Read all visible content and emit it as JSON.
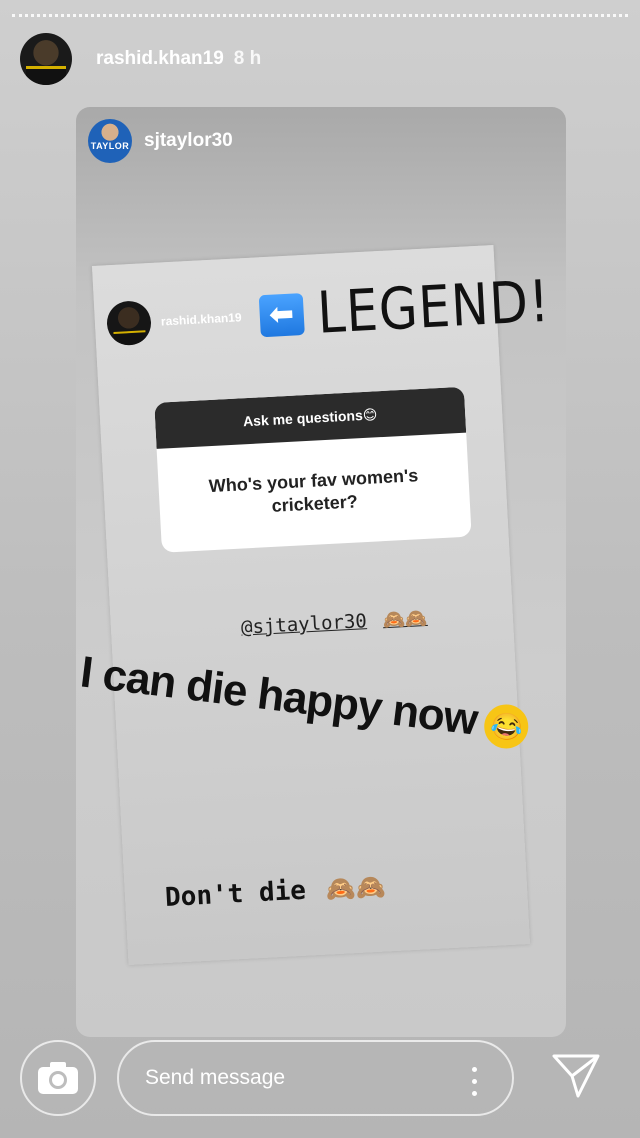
{
  "header": {
    "username": "rashid.khan19",
    "time": "8 h"
  },
  "shared_story": {
    "username": "sjtaylor30",
    "avatar_jersey_text": "TAYLOR"
  },
  "screenshot": {
    "username": "rashid.khan19",
    "arrow_glyph": "⬅",
    "legend_text": "LEGEND!",
    "question_box": {
      "header": "Ask me questions😊",
      "question": "Who's your fav women's cricketer?"
    },
    "mention": "@sjtaylor30",
    "mention_emoji": "🙈🙈",
    "big_text": "I can die happy now",
    "laugh_emoji": "😂",
    "reply_text": "Don't die",
    "reply_emoji": "🙈🙈"
  },
  "footer": {
    "message_placeholder": "Send message"
  }
}
